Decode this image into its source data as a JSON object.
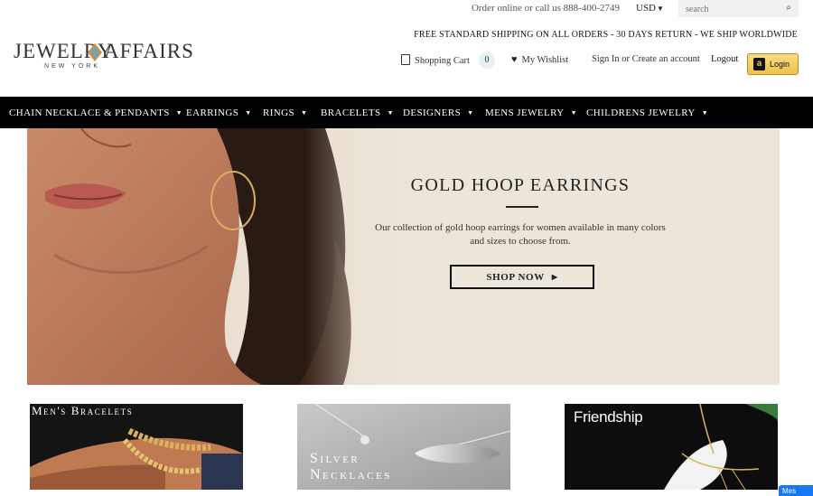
{
  "topbar": {
    "contact": "Order online or call us 888-400-2749",
    "currency": "USD",
    "search_placeholder": "search"
  },
  "logo": {
    "word1": "JEWELRY",
    "word2": "AFFAIRS",
    "subtitle": "NEW YORK"
  },
  "shipping_banner": "FREE STANDARD SHIPPING ON ALL ORDERS - 30 DAYS RETURN - WE SHIP WORLDWIDE",
  "account": {
    "cart_label": "Shopping Cart",
    "cart_count": "0",
    "wishlist_label": "My Wishlist",
    "signin_label": "Sign In or Create an account",
    "logout_label": "Logout",
    "amazon_login_label": "Login"
  },
  "nav": [
    {
      "label": "CHAIN NECKLACE & PENDANTS"
    },
    {
      "label": "EARRINGS"
    },
    {
      "label": "RINGS"
    },
    {
      "label": "BRACELETS"
    },
    {
      "label": "DESIGNERS"
    },
    {
      "label": "MENS JEWELRY"
    },
    {
      "label": "CHILDRENS JEWELRY"
    }
  ],
  "hero": {
    "title": "GOLD HOOP EARRINGS",
    "description": "Our collection of gold hoop earrings for women available in many colors and sizes to choose from.",
    "cta": "SHOP NOW"
  },
  "tiles": [
    {
      "label": "Men's Bracelets"
    },
    {
      "label_line1": "Silver",
      "label_line2": "Necklaces"
    },
    {
      "label": "Friendship"
    }
  ],
  "chat_widget": "Mes",
  "colors": {
    "navbar_bg": "#000000",
    "hero_bg": "#ece5d9",
    "amazon_button": "#f0c14b",
    "cart_badge": "#e7f2f4"
  }
}
